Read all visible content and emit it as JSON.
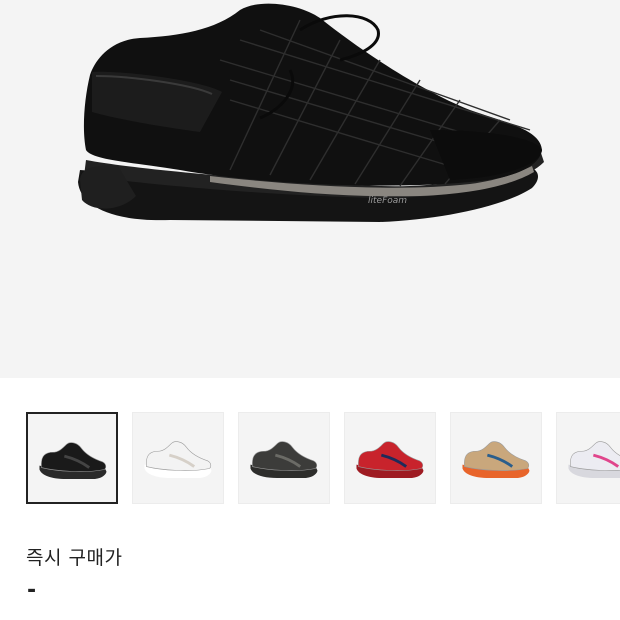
{
  "product": {
    "hero_image": "black-running-sneaker",
    "hero_bg": "#f4f4f4",
    "midsole_text": "liteFoam"
  },
  "thumbnails": [
    {
      "name": "black-sneaker",
      "upper": "#1a1a1a",
      "sole": "#2a2a2a",
      "accent": "#444444",
      "selected": true
    },
    {
      "name": "white-sneaker",
      "upper": "#f3f3f3",
      "sole": "#ffffff",
      "accent": "#d6d0c8",
      "selected": false
    },
    {
      "name": "grey-slip-on-sneaker",
      "upper": "#3c3c3a",
      "sole": "#2d2d2b",
      "accent": "#6b6b66",
      "selected": false
    },
    {
      "name": "red-sneaker",
      "upper": "#c8232c",
      "sole": "#9e1b22",
      "accent": "#1e2b5a",
      "selected": false
    },
    {
      "name": "orange-beige-sneaker",
      "upper": "#c9a77c",
      "sole": "#e8642a",
      "accent": "#2a5e8c",
      "selected": false
    },
    {
      "name": "pink-white-sneaker",
      "upper": "#ececf2",
      "sole": "#d8d8de",
      "accent": "#e0458c",
      "selected": false
    }
  ],
  "pricing": {
    "label": "즉시 구매가",
    "value": "-"
  }
}
